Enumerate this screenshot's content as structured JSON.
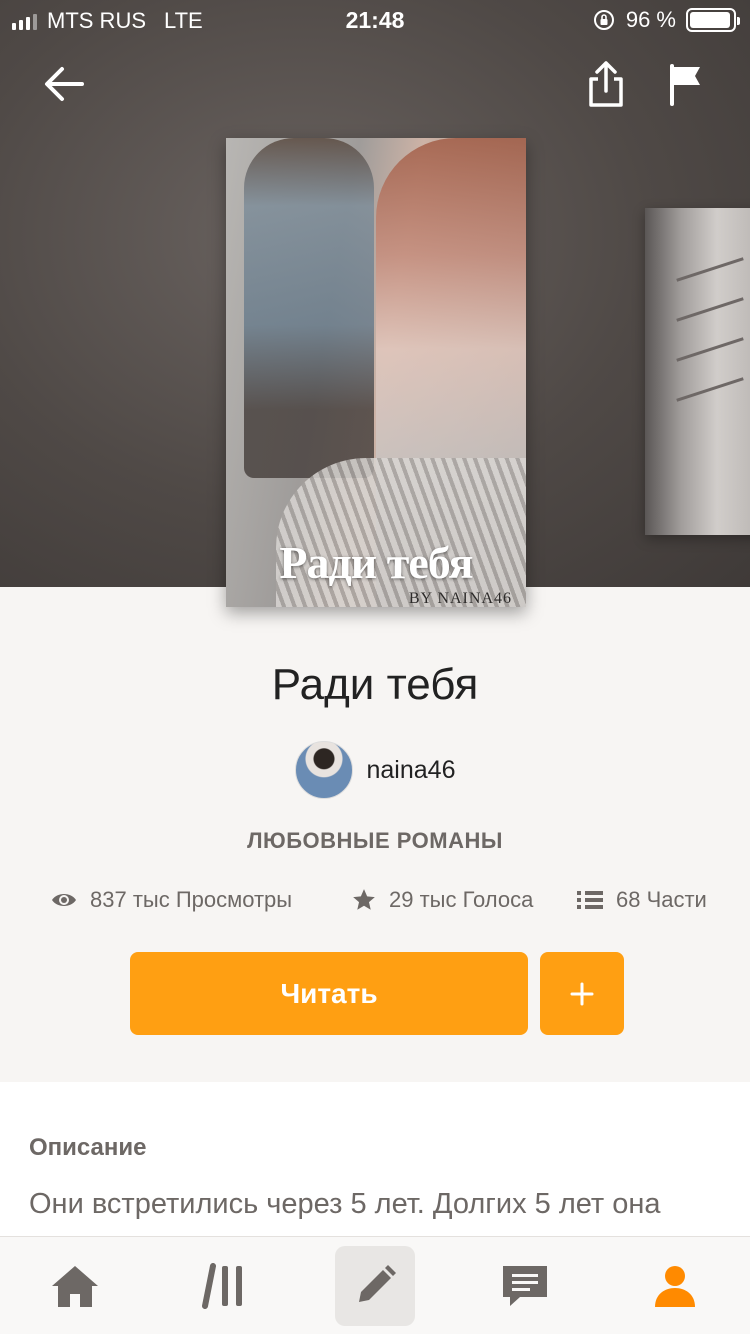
{
  "status_bar": {
    "carrier": "MTS RUS",
    "network": "LTE",
    "time": "21:48",
    "battery_percent": "96 %",
    "battery_level": 0.96
  },
  "topbar": {
    "back_icon": "arrow-left-icon",
    "share_icon": "share-icon",
    "report_icon": "flag-icon"
  },
  "cover": {
    "title": "Ради тебя",
    "byline": "BY NAINA46"
  },
  "book": {
    "title": "Ради тебя",
    "author": "naina46",
    "category": "ЛЮБОВНЫЕ РОМАНЫ"
  },
  "stats": {
    "views": "837 тыс Просмотры",
    "votes": "29 тыс Голоса",
    "parts": "68 Части"
  },
  "actions": {
    "read_label": "Читать",
    "add_label": "+"
  },
  "description": {
    "heading": "Описание",
    "text": "Они встретились через 5 лет. Долгих 5 лет она"
  },
  "tabbar": {
    "items": [
      "home-icon",
      "library-icon",
      "write-icon",
      "messages-icon",
      "profile-icon"
    ],
    "active": "write-icon",
    "accent": "#ff8a00"
  },
  "colors": {
    "accent": "#ff9f12",
    "muted_text": "#6d6865"
  }
}
